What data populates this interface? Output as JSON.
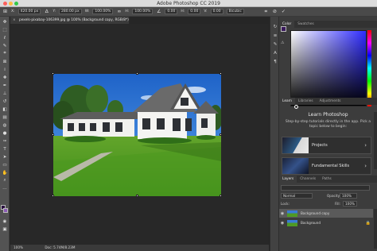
{
  "window": {
    "title": "Adobe Photoshop CC 2019"
  },
  "options_bar": {
    "width_value": "840.00 px",
    "x_value": "420.00 px",
    "y_value": "280.00 px",
    "w_value": "100.00%",
    "h_value": "100.00%",
    "rotate_value": "0.00",
    "h_skew_value": "0.00",
    "v_skew_value": "0.00",
    "interpolation": "Bicubic"
  },
  "document": {
    "tab_label": "pexels-pixabay-106399.jpg @ 100% (Background copy, RGB/8*)",
    "zoom": "100%",
    "doc_info": "Doc: 5.74M/8.23M"
  },
  "panels": {
    "color_tabs": [
      "Color",
      "Swatches"
    ],
    "learn_tabs": [
      "Learn",
      "Libraries",
      "Adjustments"
    ],
    "learn_title": "Learn Photoshop",
    "learn_desc": "Step-by-step tutorials directly in the app. Pick a topic below to begin:",
    "learn_items": [
      "Projects",
      "Fundamental Skills"
    ],
    "layers_tabs": [
      "Layers",
      "Channels",
      "Paths"
    ],
    "blend_mode": "Normal",
    "opacity_label": "Opacity:",
    "opacity_value": "100%",
    "lock_label": "Lock:",
    "fill_label": "Fill:",
    "fill_value": "100%",
    "layers": [
      "Background copy",
      "Background"
    ]
  },
  "colors": {
    "accent": "#3b8bd6",
    "background": "#262626",
    "panel": "#3c3c3c"
  }
}
